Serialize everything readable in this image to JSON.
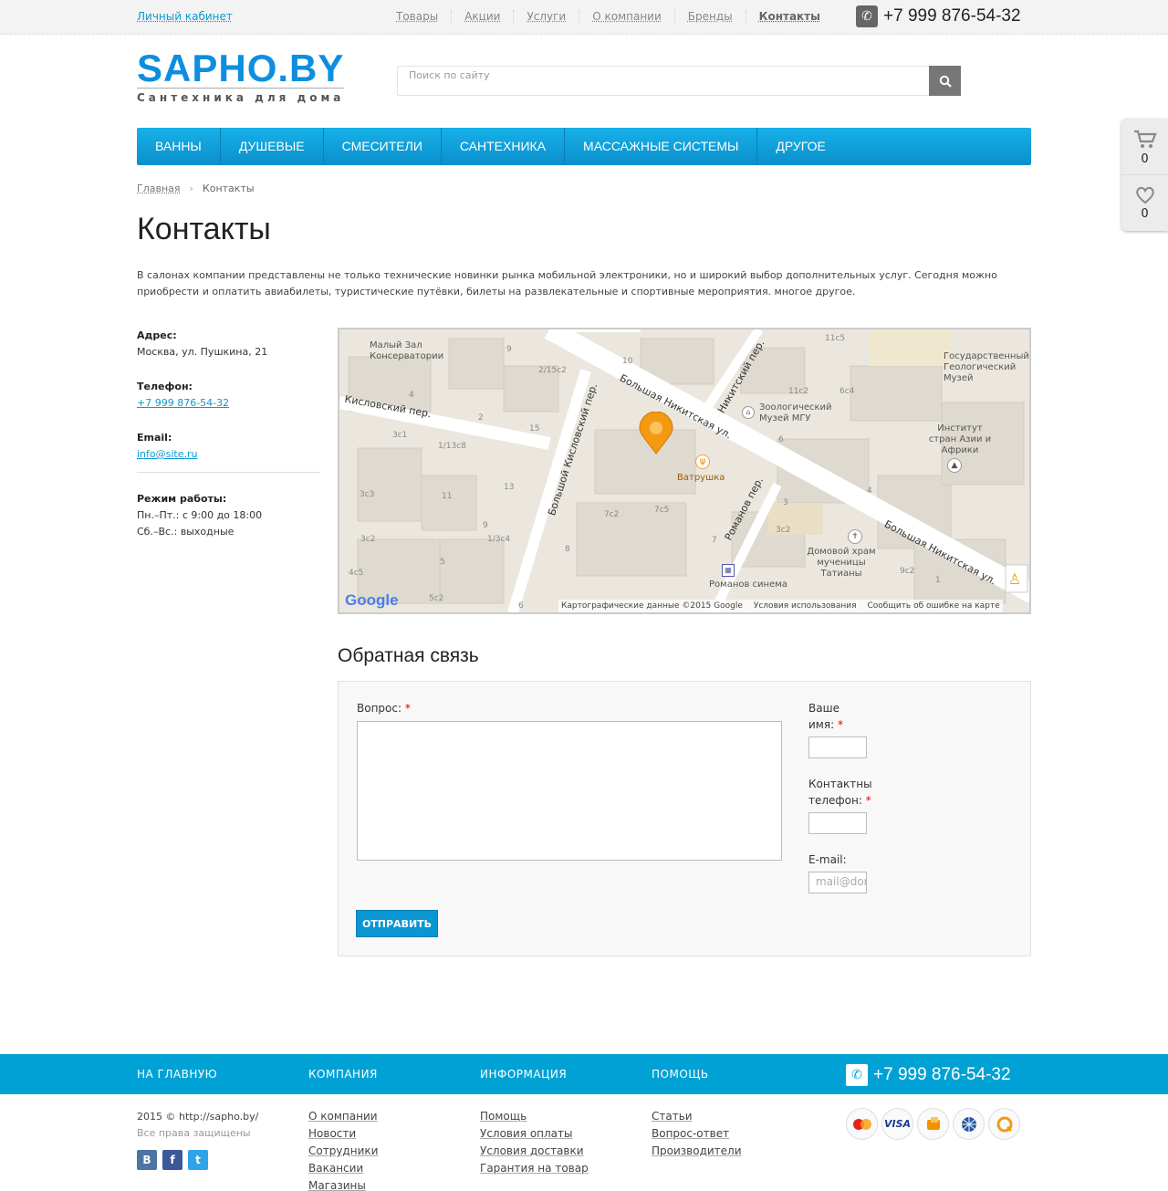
{
  "topbar": {
    "cabinet": "Личный кабинет",
    "nav": [
      "Товары",
      "Акции",
      "Услуги",
      "О компании",
      "Бренды",
      "Контакты"
    ],
    "phone": "+7 999 876-54-32"
  },
  "logo": {
    "title": "SAPHO.BY",
    "subtitle": "Сантехника для дома"
  },
  "search": {
    "placeholder": "Поиск по сайту"
  },
  "main_nav": [
    "ВАННЫ",
    "ДУШЕВЫЕ",
    "СМЕСИТЕЛИ",
    "САНТЕХНИКА",
    "МАССАЖНЫЕ СИСТЕМЫ",
    "ДРУГОЕ"
  ],
  "side_widget": {
    "cart_count": "0",
    "wishlist_count": "0"
  },
  "breadcrumb": {
    "home": "Главная",
    "current": "Контакты"
  },
  "page": {
    "title": "Контакты",
    "intro": "В салонах компании представлены не только технические новинки рынка мобильной электроники, но и широкий выбор дополнительных услуг. Сегодня можно приобрести и оплатить авиабилеты, туристические путёвки, билеты на развлекательные и спортивные мероприятия. многое другое."
  },
  "contacts": {
    "address_label": "Адрес:",
    "address": "Москва, ул. Пушкина, 21",
    "phone_label": "Телефон:",
    "phone": "+7 999 876-54-32",
    "email_label": "Email:",
    "email": "info@site.ru",
    "hours_label": "Режим работы:",
    "hours_weekdays": "Пн.–Пт.: с 9:00 до 18:00",
    "hours_weekend": "Сб.–Вс.: выходные"
  },
  "map": {
    "labels": {
      "hall": "Малый Зал Консерватории",
      "museum_geo": "Государственный Геологический Музей",
      "kislovsky": "Кисловский пер.",
      "nikitskaya": "Большая Никитская ул.",
      "nikitsky": "Никитский пер.",
      "zoo_museum": "Зоологический Музей МГУ",
      "institute": "Институт стран Азии и Африки",
      "b_kislovsky": "Большой Кисловский пер.",
      "vatrushka": "Ватрушка",
      "romanov_per": "Романов пер.",
      "church": "Домовой храм мученицы Татианы",
      "cinema": "Романов синема",
      "nikitskaya2": "Большая Никитская ул."
    },
    "house_numbers": [
      "11c5",
      "9",
      "10",
      "2/15c2",
      "6c4",
      "11c2",
      "4",
      "3c1",
      "2",
      "15",
      "1/13c8",
      "6",
      "13",
      "11",
      "4",
      "3c3",
      "9",
      "7c5",
      "7c2",
      "3",
      "3c2",
      "1/3c4",
      "8",
      "7",
      "3c2",
      "5",
      "4c5",
      "9c2",
      "1",
      "5c2",
      "6"
    ],
    "google": "Google",
    "footer_data": "Картографические данные ©2015 Google",
    "footer_terms": "Условия использования",
    "footer_report": "Сообщить об ошибке на карте"
  },
  "feedback": {
    "title": "Обратная связь",
    "question_label": "Вопрос:",
    "name_label_1": "Ваше",
    "name_label_2": "имя:",
    "phone_label_1": "Контактны",
    "phone_label_2": "телефон:",
    "email_label": "E-mail:",
    "email_placeholder": "mail@domain.com",
    "required_mark": "*",
    "submit": "ОТПРАВИТЬ"
  },
  "footer": {
    "headers": [
      "НА ГЛАВНУЮ",
      "КОМПАНИЯ",
      "ИНФОРМАЦИЯ",
      "ПОМОЩЬ"
    ],
    "phone": "+7 999 876-54-32",
    "copyright": "2015 © http://sapho.by/",
    "rights": "Все права защищены",
    "social": [
      "В",
      "f",
      "t"
    ],
    "company_links": [
      "О компании",
      "Новости",
      "Сотрудники",
      "Вакансии",
      "Магазины"
    ],
    "info_links": [
      "Помощь",
      "Условия оплаты",
      "Условия доставки",
      "Гарантия на товар"
    ],
    "help_links": [
      "Статьи",
      "Вопрос-ответ",
      "Производители"
    ],
    "payments": [
      "mastercard-icon",
      "visa-icon",
      "yandex-money-icon",
      "webmoney-icon",
      "qiwi-icon"
    ]
  }
}
